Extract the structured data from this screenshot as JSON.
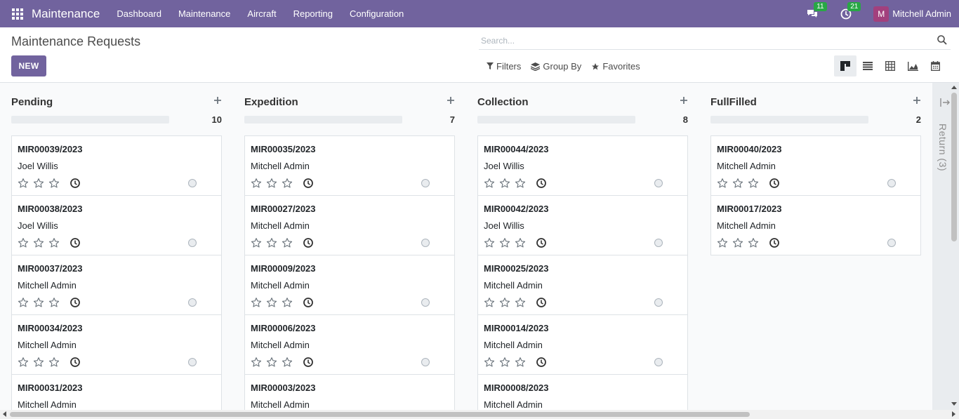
{
  "navbar": {
    "app_name": "Maintenance",
    "menu": [
      "Dashboard",
      "Maintenance",
      "Aircraft",
      "Reporting",
      "Configuration"
    ],
    "messages_count": "11",
    "activities_count": "21",
    "user_initial": "M",
    "user_name": "Mitchell Admin",
    "bg_color": "#71639e"
  },
  "control": {
    "title": "Maintenance Requests",
    "new_label": "NEW",
    "search_placeholder": "Search...",
    "filters_label": "Filters",
    "group_by_label": "Group By",
    "favorites_label": "Favorites",
    "views": [
      "kanban-icon",
      "list-icon",
      "pivot-icon",
      "graph-icon",
      "calendar-icon"
    ],
    "active_view": "kanban-icon"
  },
  "columns": [
    {
      "title": "Pending",
      "count": "10",
      "cards": [
        {
          "ref": "MIR00039/2023",
          "user": "Joel Willis"
        },
        {
          "ref": "MIR00038/2023",
          "user": "Joel Willis"
        },
        {
          "ref": "MIR00037/2023",
          "user": "Mitchell Admin"
        },
        {
          "ref": "MIR00034/2023",
          "user": "Mitchell Admin"
        },
        {
          "ref": "MIR00031/2023",
          "user": "Mitchell Admin"
        }
      ]
    },
    {
      "title": "Expedition",
      "count": "7",
      "cards": [
        {
          "ref": "MIR00035/2023",
          "user": "Mitchell Admin"
        },
        {
          "ref": "MIR00027/2023",
          "user": "Mitchell Admin"
        },
        {
          "ref": "MIR00009/2023",
          "user": "Mitchell Admin"
        },
        {
          "ref": "MIR00006/2023",
          "user": "Mitchell Admin"
        },
        {
          "ref": "MIR00003/2023",
          "user": "Mitchell Admin"
        }
      ]
    },
    {
      "title": "Collection",
      "count": "8",
      "cards": [
        {
          "ref": "MIR00044/2023",
          "user": "Joel Willis"
        },
        {
          "ref": "MIR00042/2023",
          "user": "Joel Willis"
        },
        {
          "ref": "MIR00025/2023",
          "user": "Mitchell Admin"
        },
        {
          "ref": "MIR00014/2023",
          "user": "Mitchell Admin"
        },
        {
          "ref": "MIR00008/2023",
          "user": "Mitchell Admin"
        }
      ]
    },
    {
      "title": "FullFilled",
      "count": "2",
      "cards": [
        {
          "ref": "MIR00040/2023",
          "user": "Mitchell Admin"
        },
        {
          "ref": "MIR00017/2023",
          "user": "Mitchell Admin"
        }
      ]
    }
  ],
  "folded_column": {
    "label": "Return (3)"
  }
}
